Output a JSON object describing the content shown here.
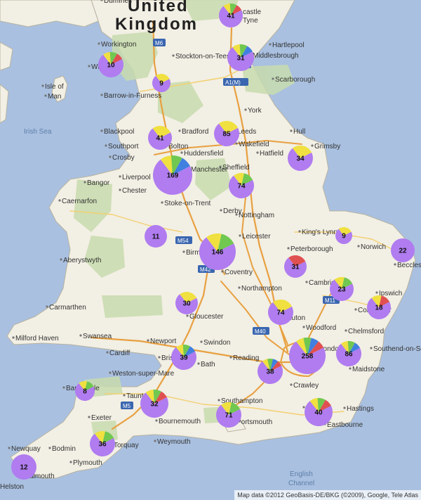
{
  "map": {
    "country_label": [
      "United",
      "Kingdom"
    ],
    "sea_labels": [
      {
        "name": "irish-sea",
        "text": "Irish Sea"
      },
      {
        "name": "english-channel-1",
        "text": "English"
      },
      {
        "name": "english-channel-2",
        "text": "Channel"
      }
    ],
    "places": [
      "castle",
      "Tyne",
      "Workington",
      "Stockton-on-Tees",
      "Hartlepool",
      "Middlesbrough",
      "Whitby",
      "Barrow-in-Furness",
      "Scarborough",
      "York",
      "Blackpool",
      "Bradford",
      "Leeds",
      "Hull",
      "Southport",
      "Bolton",
      "Huddersfield",
      "Wakefield",
      "Crosby",
      "Hatfield",
      "Grimsby",
      "Sheffield",
      "Liverpool",
      "Manchester",
      "Bangor",
      "Chester",
      "Caernarfon",
      "Stoke-on-Trent",
      "Derby",
      "Nottingham",
      "King's Lynn",
      "Leicester",
      "Peterborough",
      "Norwich",
      "Aberystwyth",
      "Birmingham",
      "Coventry",
      "Beccles",
      "Northampton",
      "Cambridge",
      "Ipswich",
      "Carmarthen",
      "Gloucester",
      "Colchester",
      "Luton",
      "Milford Haven",
      "Swansea",
      "Newport",
      "Woodford",
      "Chelmsford",
      "Cardiff",
      "Swindon",
      "Southend-on-Sea",
      "Bristol",
      "Bath",
      "Reading",
      "London",
      "Weston-super-Mare",
      "Maidstone",
      "Crawley",
      "Barnstaple",
      "Taunton",
      "Southampton",
      "Brighton",
      "Hastings",
      "Exeter",
      "Bournemouth",
      "Portsmouth",
      "Weymouth",
      "Eastbourne",
      "Torquay",
      "Newquay",
      "Bodmin",
      "Plymouth",
      "Falmouth",
      "Helston",
      "Isle of",
      "Man",
      "Dumfries"
    ],
    "roads": [
      "M6",
      "A1(M)",
      "M54",
      "M42",
      "M11",
      "M40",
      "M5",
      "A1"
    ],
    "markers": [
      {
        "count": "41",
        "colors": [
          "#b07cf0",
          "#f0e040",
          "#70c850",
          "#e05050"
        ]
      },
      {
        "count": "10",
        "colors": [
          "#b07cf0",
          "#f0e040",
          "#70c850",
          "#e05050"
        ]
      },
      {
        "count": "31",
        "colors": [
          "#b07cf0",
          "#f0e040",
          "#70c850",
          "#4080e0"
        ]
      },
      {
        "count": "9",
        "colors": [
          "#b07cf0",
          "#f0e040"
        ]
      },
      {
        "count": "41",
        "colors": [
          "#b07cf0",
          "#f0e040"
        ]
      },
      {
        "count": "85",
        "colors": [
          "#b07cf0",
          "#f0e040"
        ]
      },
      {
        "count": "34",
        "colors": [
          "#b07cf0",
          "#f0e040"
        ]
      },
      {
        "count": "169",
        "colors": [
          "#b07cf0",
          "#f0e040",
          "#70c850",
          "#4080e0"
        ]
      },
      {
        "count": "74",
        "colors": [
          "#b07cf0",
          "#f0e040",
          "#70c850"
        ]
      },
      {
        "count": "11",
        "colors": [
          "#b07cf0"
        ]
      },
      {
        "count": "146",
        "colors": [
          "#b07cf0",
          "#f0e040",
          "#70c850"
        ]
      },
      {
        "count": "9",
        "colors": [
          "#b07cf0",
          "#f0e040"
        ]
      },
      {
        "count": "22",
        "colors": [
          "#b07cf0"
        ]
      },
      {
        "count": "31",
        "colors": [
          "#b07cf0",
          "#e05050"
        ]
      },
      {
        "count": "23",
        "colors": [
          "#b07cf0",
          "#f0e040",
          "#70c850"
        ]
      },
      {
        "count": "30",
        "colors": [
          "#b07cf0",
          "#f0e040"
        ]
      },
      {
        "count": "74",
        "colors": [
          "#b07cf0",
          "#f0e040"
        ]
      },
      {
        "count": "18",
        "colors": [
          "#b07cf0",
          "#f0e040",
          "#e05050"
        ]
      },
      {
        "count": "39",
        "colors": [
          "#b07cf0",
          "#f0e040",
          "#70c850",
          "#4080e0"
        ]
      },
      {
        "count": "258",
        "colors": [
          "#b07cf0",
          "#f0e040",
          "#70c850",
          "#4080e0",
          "#e05050"
        ]
      },
      {
        "count": "86",
        "colors": [
          "#b07cf0",
          "#f0e040",
          "#70c850",
          "#4080e0"
        ]
      },
      {
        "count": "38",
        "colors": [
          "#b07cf0",
          "#f0e040",
          "#70c850",
          "#4080e0",
          "#e05050"
        ]
      },
      {
        "count": "8",
        "colors": [
          "#b07cf0",
          "#f0e040",
          "#70c850"
        ]
      },
      {
        "count": "32",
        "colors": [
          "#b07cf0",
          "#f0e040",
          "#70c850",
          "#e05050"
        ]
      },
      {
        "count": "71",
        "colors": [
          "#b07cf0",
          "#f0e040",
          "#70c850"
        ]
      },
      {
        "count": "40",
        "colors": [
          "#b07cf0",
          "#f0e040",
          "#70c850",
          "#e05050"
        ]
      },
      {
        "count": "36",
        "colors": [
          "#b07cf0",
          "#f0e040",
          "#70c850"
        ]
      },
      {
        "count": "12",
        "colors": [
          "#b07cf0"
        ]
      }
    ],
    "attribution": "Map data ©2012 GeoBasis-DE/BKG (©2009), Google, Tele Atlas"
  }
}
